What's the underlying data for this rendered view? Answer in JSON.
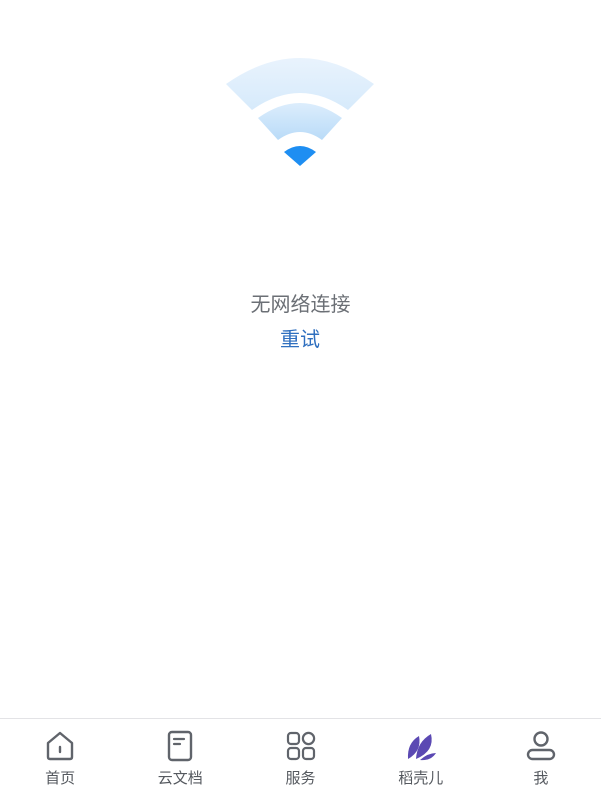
{
  "colors": {
    "accent": "#2f6fbf",
    "wifi_dot": "#1e8ef2",
    "wifi_arcs": "#cfe6fb",
    "tab_icon": "#60646b",
    "daoke_icon": "#5b49b3",
    "message": "#6b6f75"
  },
  "empty_state": {
    "icon": "wifi-icon",
    "message": "无网络连接",
    "retry_label": "重试"
  },
  "tab_bar": {
    "tabs": [
      {
        "label": "首页",
        "icon": "home-icon"
      },
      {
        "label": "云文档",
        "icon": "document-icon"
      },
      {
        "label": "服务",
        "icon": "grid-icon"
      },
      {
        "label": "稻壳儿",
        "icon": "daoke-leaf-icon"
      },
      {
        "label": "我",
        "icon": "user-icon"
      }
    ]
  }
}
